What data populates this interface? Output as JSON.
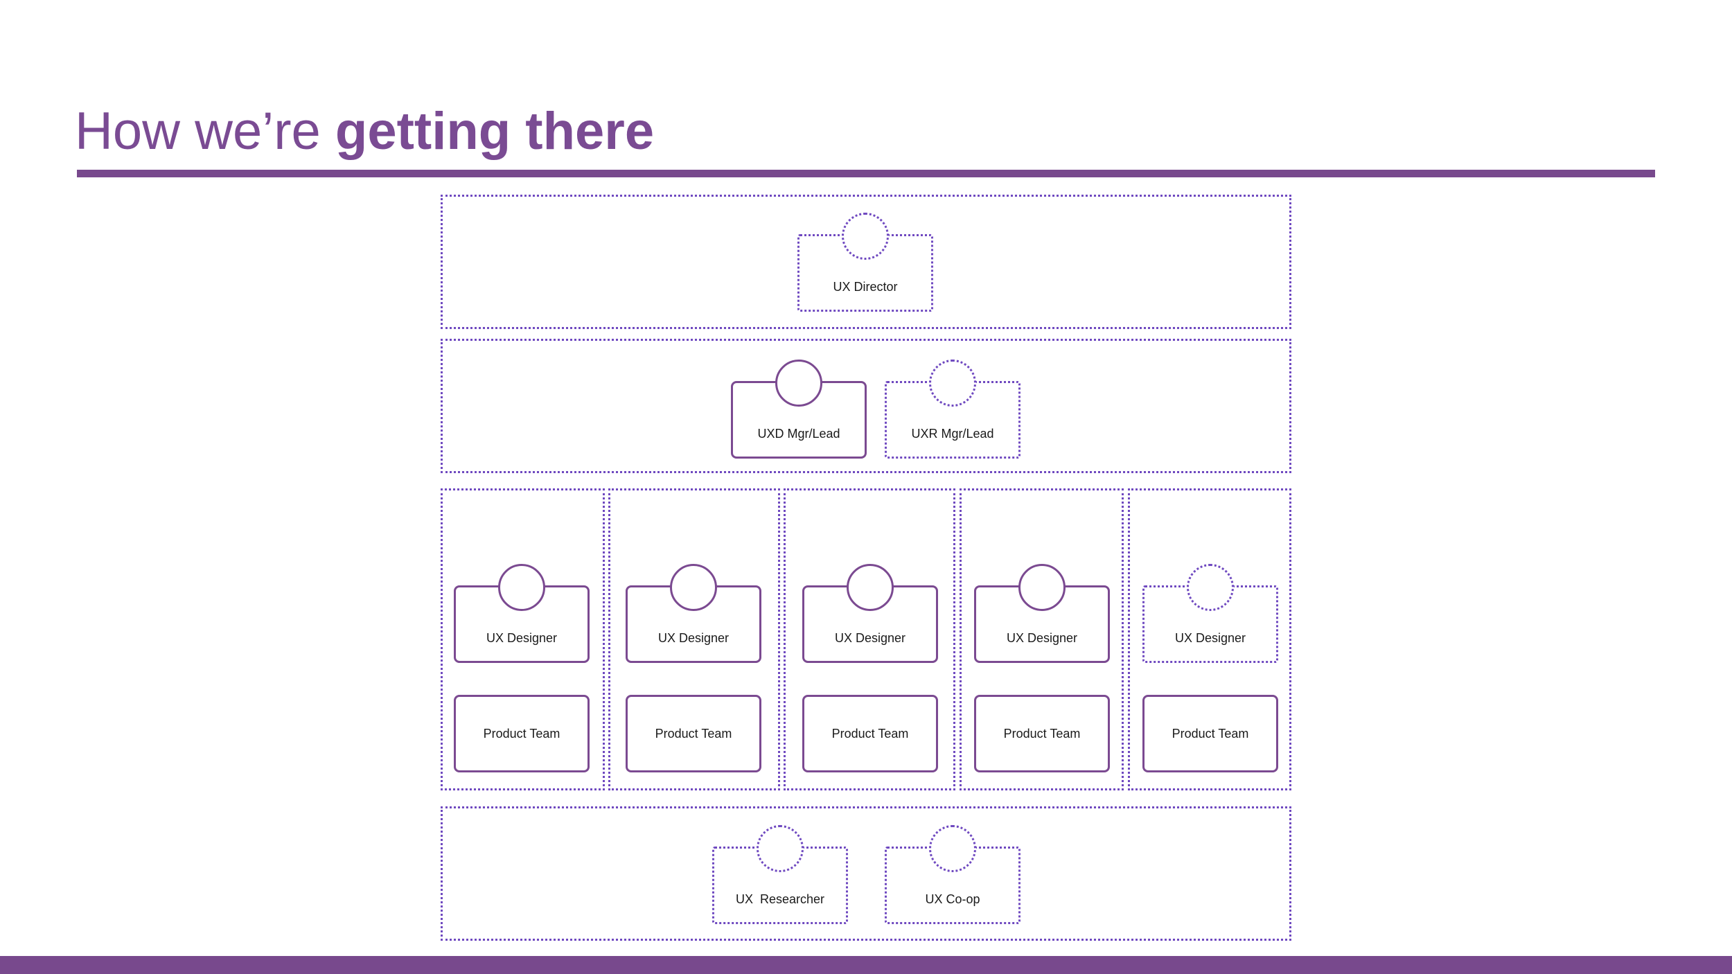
{
  "slide": {
    "title_regular": "How we’re ",
    "title_bold": "getting there"
  },
  "org": {
    "director": "UX Director",
    "uxd_lead": "UXD Mgr/Lead",
    "uxr_lead": "UXR Mgr/Lead",
    "designers": [
      "UX Designer",
      "UX Designer",
      "UX Designer",
      "UX Designer",
      "UX Designer"
    ],
    "teams": [
      "Product Team",
      "Product Team",
      "Product Team",
      "Product Team",
      "Product Team"
    ],
    "researcher": "UX  Researcher",
    "coop": "UX Co-op"
  },
  "colors": {
    "accent": "#78498d",
    "dotted_outline": "#6f49c0"
  }
}
